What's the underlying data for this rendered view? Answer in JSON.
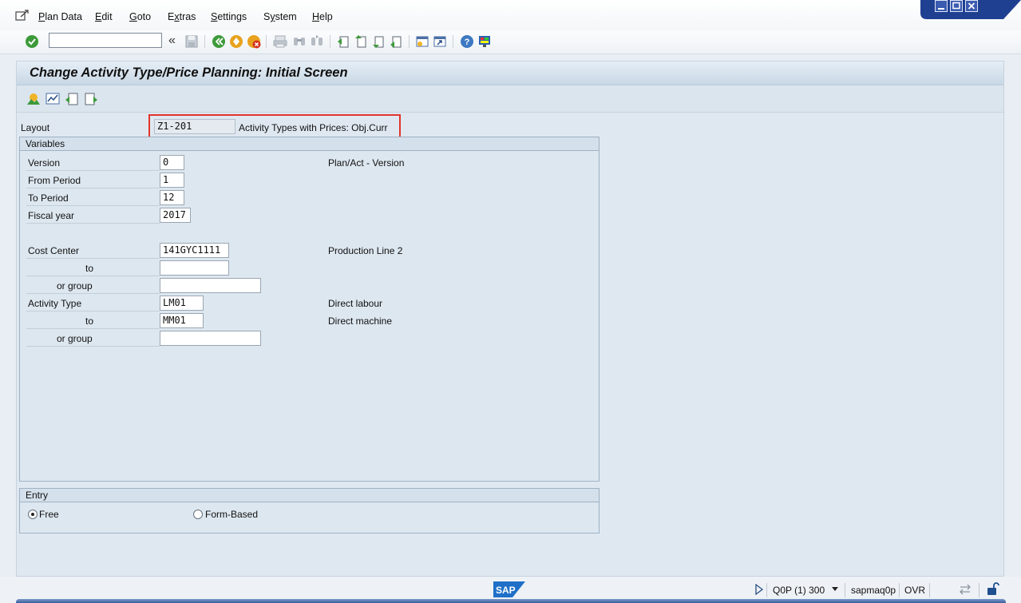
{
  "menubar": {
    "items": [
      "Plan Data",
      "Edit",
      "Goto",
      "Extras",
      "Settings",
      "System",
      "Help"
    ],
    "underline_chars": [
      "P",
      "E",
      "G",
      "x",
      "S",
      "y",
      "H"
    ]
  },
  "toolbar": {
    "command_field_value": "",
    "icons": [
      "enter-icon",
      "save-icon",
      "back-icon",
      "exit-icon",
      "cancel-icon",
      "print-icon",
      "find-icon",
      "find-next-icon",
      "first-page-icon",
      "previous-page-icon",
      "next-page-icon",
      "last-page-icon",
      "create-session-icon",
      "shortcut-icon",
      "help-icon",
      "customize-layout-icon"
    ]
  },
  "screen": {
    "title": "Change Activity Type/Price Planning: Initial Screen"
  },
  "layout_row": {
    "label": "Layout",
    "value": "Z1-201",
    "description": "Activity Types with Prices: Obj.Curr"
  },
  "variables": {
    "title": "Variables",
    "version": {
      "label": "Version",
      "value": "0",
      "description": "Plan/Act - Version"
    },
    "from_period": {
      "label": "From Period",
      "value": "1"
    },
    "to_period": {
      "label": "To Period",
      "value": "12"
    },
    "fiscal_year": {
      "label": "Fiscal year",
      "value": "2017"
    },
    "cost_center": {
      "label": "Cost Center",
      "value": "141GYC1111",
      "description": "Production Line 2"
    },
    "cost_center_to": {
      "label": "to",
      "value": ""
    },
    "cost_center_group": {
      "label": "or group",
      "value": ""
    },
    "activity_type": {
      "label": "Activity Type",
      "value": "LM01",
      "description": "Direct labour"
    },
    "activity_type_to": {
      "label": "to",
      "value": "MM01",
      "description": "Direct machine"
    },
    "activity_type_group": {
      "label": "or group",
      "value": ""
    }
  },
  "entry": {
    "title": "Entry",
    "options": [
      {
        "label": "Free",
        "selected": true
      },
      {
        "label": "Form-Based",
        "selected": false
      }
    ]
  },
  "statusbar": {
    "logo_text": "SAP",
    "system": "Q0P (1) 300",
    "server": "sapmaq0p",
    "mode": "OVR"
  },
  "colors": {
    "highlight": "#e0342b",
    "window_controls": "#1f3f91"
  }
}
